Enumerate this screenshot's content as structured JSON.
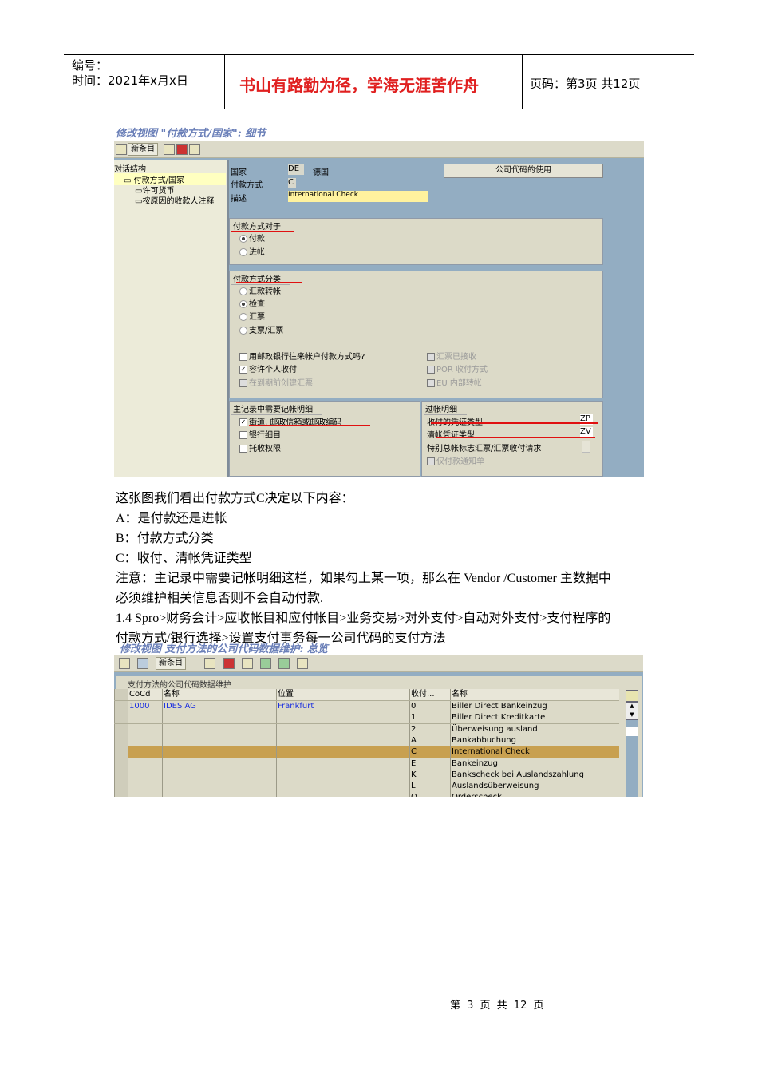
{
  "header": {
    "number_label": "编号：",
    "date_label": "时间：2021年x月x日",
    "motto": "书山有路勤为径，学海无涯苦作舟",
    "page_label": "页码：第3页  共12页"
  },
  "shot1": {
    "title": "修改视图 \"付款方式/国家\": 细节",
    "toolbar": {
      "new_entry": "新条目"
    },
    "tree": {
      "header": "对话结构",
      "items": [
        "付款方式/国家",
        "许可货币",
        "按原因的收款人注释"
      ]
    },
    "fields": [
      {
        "label": "国家",
        "value": "DE",
        "extra": "德国"
      },
      {
        "label": "付款方式",
        "value": "C"
      },
      {
        "label": "描述",
        "value": "International Check"
      }
    ],
    "company_code_button": "公司代码的使用",
    "group_for": {
      "title": "付款方式对于",
      "options": [
        "付款",
        "进帐"
      ],
      "selected": 0
    },
    "group_class": {
      "title": "付款方式分类",
      "options": [
        "汇款转帐",
        "检查",
        "汇票",
        "支票/汇票"
      ],
      "selected": 1,
      "checks_left": [
        {
          "label": "用邮政银行往来帐户付款方式吗?",
          "checked": false,
          "disabled": false
        },
        {
          "label": "容许个人收付",
          "checked": true,
          "disabled": false
        },
        {
          "label": "在到期前创建汇票",
          "checked": false,
          "disabled": true
        }
      ],
      "checks_right": [
        {
          "label": "汇票已接收",
          "disabled": true
        },
        {
          "label": "POR 收付方式",
          "disabled": true
        },
        {
          "label": "EU 内部转帐",
          "disabled": true
        }
      ]
    },
    "group_master": {
      "title": "主记录中需要记帐明细",
      "checks": [
        {
          "label": "街道, 邮政信箱或邮政编码",
          "checked": true
        },
        {
          "label": "银行细目",
          "checked": false
        },
        {
          "label": "托收权限",
          "checked": false
        }
      ]
    },
    "group_posting": {
      "title": "过帐明细",
      "rows": [
        {
          "label": "收付的凭证类型",
          "value": "ZP"
        },
        {
          "label": "清帐凭证类型",
          "value": "ZV"
        },
        {
          "label": "特别总帐标志汇票/汇票收付请求",
          "value": ""
        }
      ],
      "check": "仅付款通知单"
    }
  },
  "text": {
    "lines": [
      "这张图我们看出付款方式C决定以下内容：",
      "A：是付款还是进帐",
      "B：付款方式分类",
      "C：收付、清帐凭证类型",
      "注意：主记录中需要记帐明细这栏，如果勾上某一项，那么在 Vendor /Customer 主数据中",
      "必须维护相关信息否则不会自动付款.",
      "1.4 Spro>财务会计>应收帐目和应付帐目>业务交易>对外支付>自动对外支付>支付程序的",
      "付款方式/银行选择>设置支付事务每一公司代码的支付方法"
    ]
  },
  "shot2": {
    "title": "修改视图 支付方法的公司代码数据维护: 总览",
    "toolbar": {
      "new_entry": "新条目"
    },
    "table_title": "支付方法的公司代码数据维护",
    "columns": [
      "CoCd",
      "名称",
      "位置",
      "收付...",
      "名称"
    ],
    "rows": [
      [
        "1000",
        "IDES AG",
        "Frankfurt",
        "0",
        "Biller Direct Bankeinzug"
      ],
      [
        "",
        "",
        "",
        "1",
        "Biller Direct Kreditkarte"
      ],
      [
        "",
        "",
        "",
        "2",
        "Überweisung ausland"
      ],
      [
        "",
        "",
        "",
        "A",
        "Bankabbuchung"
      ],
      [
        "",
        "",
        "",
        "C",
        "International Check"
      ],
      [
        "",
        "",
        "",
        "E",
        "Bankeinzug"
      ],
      [
        "",
        "",
        "",
        "K",
        "Bankscheck bei Auslandszahlung"
      ],
      [
        "",
        "",
        "",
        "L",
        "Auslandsüberweisung"
      ],
      [
        "",
        "",
        "",
        "O",
        "Orderscheck"
      ]
    ],
    "selected_row": 4
  },
  "footer": {
    "page": "第 3 页 共 12 页"
  }
}
